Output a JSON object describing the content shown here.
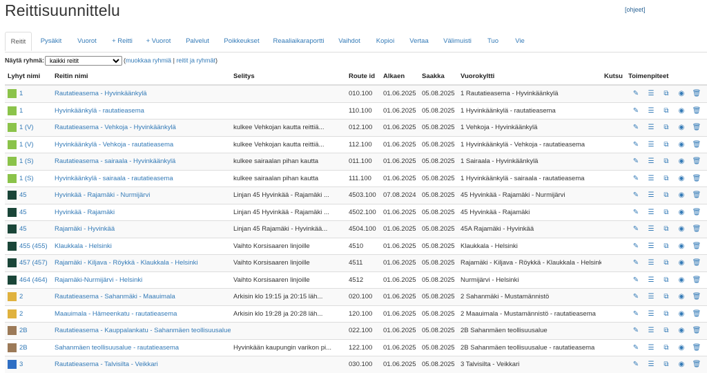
{
  "page": {
    "title": "Reittisuunnittelu",
    "help_link": "[ohjeet]"
  },
  "tabs": [
    {
      "label": "Reitit",
      "active": true
    },
    {
      "label": "Pysäkit"
    },
    {
      "label": "Vuorot"
    },
    {
      "label": "+ Reitti"
    },
    {
      "label": "+ Vuorot"
    },
    {
      "label": "Palvelut"
    },
    {
      "label": "Poikkeukset"
    },
    {
      "label": "Reaaliaikaraportti"
    },
    {
      "label": "Vaihdot"
    },
    {
      "label": "Kopioi"
    },
    {
      "label": "Vertaa"
    },
    {
      "label": "Välimuisti"
    },
    {
      "label": "Tuo"
    },
    {
      "label": "Vie"
    }
  ],
  "filter": {
    "label": "Näytä ryhmä:",
    "selected": "kaikki reitit",
    "open_paren": "(",
    "edit_groups_link": "muokkaa ryhmiä",
    "separator": "|",
    "routes_groups_link": "reitit ja ryhmät",
    "close_paren": ")"
  },
  "table": {
    "headers": [
      "Lyhyt nimi",
      "Reitin nimi",
      "Selitys",
      "Route id",
      "Alkaen",
      "Saakka",
      "Vuorokyltti",
      "Kutsu",
      "Toimenpiteet"
    ],
    "rows": [
      {
        "color": "#8bc34a",
        "short": "1",
        "name": "Rautatieasema - Hyvinkäänkylä",
        "desc": "",
        "route_id": "010.100",
        "from": "01.06.2025",
        "to": "05.08.2025",
        "sign": "1 Rautatieasema - Hyvinkäänkylä",
        "call": ""
      },
      {
        "color": "#8bc34a",
        "short": "1",
        "name": "Hyvinkäänkylä - rautatieasema",
        "desc": "",
        "route_id": "110.100",
        "from": "01.06.2025",
        "to": "05.08.2025",
        "sign": "1 Hyvinkäänkylä - rautatieasema",
        "call": ""
      },
      {
        "color": "#8bc34a",
        "short": "1 (V)",
        "name": "Rautatieasema - Vehkoja - Hyvinkäänkylä",
        "desc": "kulkee Vehkojan kautta reittiä...",
        "route_id": "012.100",
        "from": "01.06.2025",
        "to": "05.08.2025",
        "sign": "1 Vehkoja - Hyvinkäänkylä",
        "call": ""
      },
      {
        "color": "#8bc34a",
        "short": "1 (V)",
        "name": "Hyvinkäänkylä - Vehkoja - rautatieasema",
        "desc": "kulkee Vehkojan kautta reittiä...",
        "route_id": "112.100",
        "from": "01.06.2025",
        "to": "05.08.2025",
        "sign": "1 Hyvinkäänkylä - Vehkoja - rautatieasema",
        "call": ""
      },
      {
        "color": "#8bc34a",
        "short": "1 (S)",
        "name": "Rautatieasema - sairaala - Hyvinkäänkylä",
        "desc": "kulkee sairaalan pihan kautta",
        "route_id": "011.100",
        "from": "01.06.2025",
        "to": "05.08.2025",
        "sign": "1 Sairaala - Hyvinkäänkylä",
        "call": ""
      },
      {
        "color": "#8bc34a",
        "short": "1 (S)",
        "name": "Hyvinkäänkylä - sairaala - rautatieasema",
        "desc": "kulkee sairaalan pihan kautta",
        "route_id": "111.100",
        "from": "01.06.2025",
        "to": "05.08.2025",
        "sign": "1 Hyvinkäänkylä - sairaala - rautatieasema",
        "call": ""
      },
      {
        "color": "#1a4538",
        "short": "45",
        "name": "Hyvinkää - Rajamäki - Nurmijärvi",
        "desc": "Linjan 45 Hyvinkää - Rajamäki ...",
        "route_id": "4503.100",
        "from": "07.08.2024",
        "to": "05.08.2025",
        "sign": "45 Hyvinkää - Rajamäki - Nurmijärvi",
        "call": ""
      },
      {
        "color": "#1a4538",
        "short": "45",
        "name": "Hyvinkää - Rajamäki",
        "desc": "Linjan 45 Hyvinkää - Rajamäki ...",
        "route_id": "4502.100",
        "from": "01.06.2025",
        "to": "05.08.2025",
        "sign": "45 Hyvinkää - Rajamäki",
        "call": ""
      },
      {
        "color": "#1a4538",
        "short": "45",
        "name": "Rajamäki - Hyvinkää",
        "desc": "Linjan 45 Rajamäki - Hyvinkää...",
        "route_id": "4504.100",
        "from": "01.06.2025",
        "to": "05.08.2025",
        "sign": "45A Rajamäki - Hyvinkää",
        "call": ""
      },
      {
        "color": "#1a4538",
        "short": "455 (455)",
        "name": "Klaukkala - Helsinki",
        "desc": "Vaihto Korsisaaren linjoille",
        "route_id": "4510",
        "from": "01.06.2025",
        "to": "05.08.2025",
        "sign": "Klaukkala - Helsinki",
        "call": ""
      },
      {
        "color": "#1a4538",
        "short": "457 (457)",
        "name": "Rajamäki - Kiljava - Röykkä - Klaukkala - Helsinki",
        "desc": "Vaihto Korsisaaren linjoille",
        "route_id": "4511",
        "from": "01.06.2025",
        "to": "05.08.2025",
        "sign": "Rajamäki - Kiljava - Röykkä - Klaukkala - Helsinki",
        "call": ""
      },
      {
        "color": "#1a4538",
        "short": "464 (464)",
        "name": "Rajamäki-Nurmijärvi - Helsinki",
        "desc": "Vaihto Korsisaaren linjoille",
        "route_id": "4512",
        "from": "01.06.2025",
        "to": "05.08.2025",
        "sign": "Nurmijärvi - Helsinki",
        "call": ""
      },
      {
        "color": "#e0b23e",
        "short": "2",
        "name": "Rautatieasema - Sahanmäki - Maauimala",
        "desc": "Arkisin klo 19:15 ja 20:15 läh...",
        "route_id": "020.100",
        "from": "01.06.2025",
        "to": "05.08.2025",
        "sign": "2 Sahanmäki - Mustamännistö",
        "call": ""
      },
      {
        "color": "#e0b23e",
        "short": "2",
        "name": "Maauimala - Hämeenkatu - rautatieasema",
        "desc": "Arkisin klo 19:28 ja 20:28 läh...",
        "route_id": "120.100",
        "from": "01.06.2025",
        "to": "05.08.2025",
        "sign": "2 Maauimala - Mustamännistö - rautatieasema",
        "call": ""
      },
      {
        "color": "#9c7a58",
        "short": "2B",
        "name": "Rautatieasema - Kauppalankatu - Sahanmäen teollisuusalue",
        "desc": "",
        "route_id": "022.100",
        "from": "01.06.2025",
        "to": "05.08.2025",
        "sign": "2B Sahanmäen teollisuusalue",
        "call": ""
      },
      {
        "color": "#9c7a58",
        "short": "2B",
        "name": "Sahanmäen teollisuusalue - rautatieasema",
        "desc": "Hyvinkään kaupungin varikon pi...",
        "route_id": "122.100",
        "from": "01.06.2025",
        "to": "05.08.2025",
        "sign": "2B Sahanmäen teollisuusalue - rautatieasema",
        "call": ""
      },
      {
        "color": "#2f6fc4",
        "short": "3",
        "name": "Rautatieasema - Talvisilta - Veikkari",
        "desc": "",
        "route_id": "030.100",
        "from": "01.06.2025",
        "to": "05.08.2025",
        "sign": "3 Talvisilta - Veikkari",
        "call": ""
      }
    ],
    "actions": [
      {
        "icon": "edit-icon",
        "glyph": "✎"
      },
      {
        "icon": "list-icon",
        "glyph": "☰"
      },
      {
        "icon": "copy-icon",
        "glyph": "⧉"
      },
      {
        "icon": "view-icon",
        "glyph": "◉"
      },
      {
        "icon": "trash-icon",
        "glyph": "🗑"
      }
    ]
  }
}
